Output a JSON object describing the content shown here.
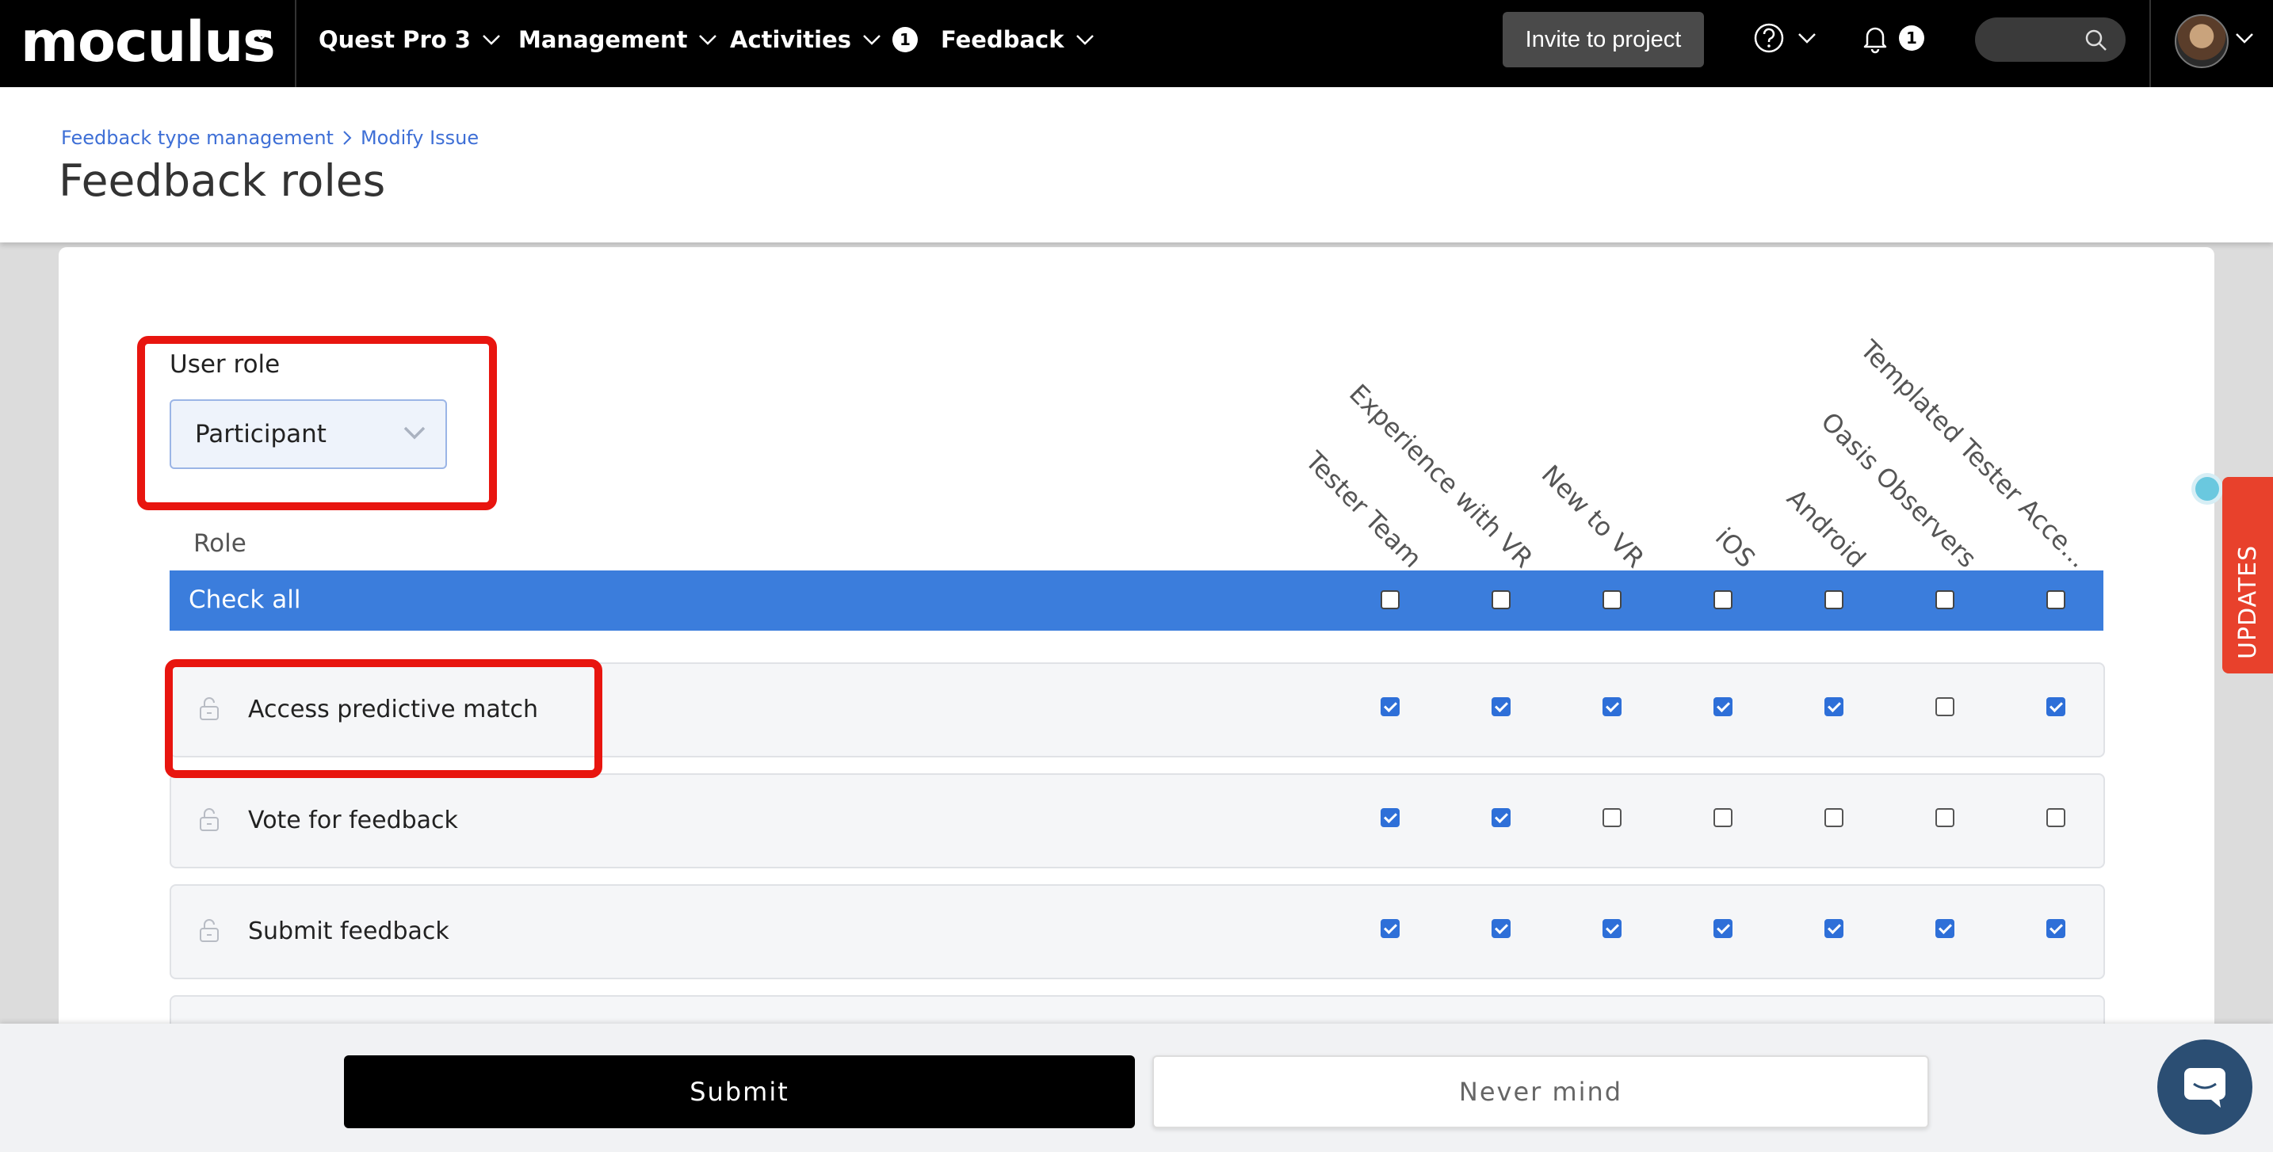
{
  "nav": {
    "logo": "moculus",
    "items": [
      {
        "label": "Quest Pro 3"
      },
      {
        "label": "Management"
      },
      {
        "label": "Activities",
        "badge": "1"
      },
      {
        "label": "Feedback"
      }
    ],
    "invite_label": "Invite to project",
    "notifications_badge": "1",
    "icons": [
      "help-icon",
      "bell-icon",
      "search-icon"
    ]
  },
  "header": {
    "breadcrumb": [
      "Feedback type management",
      "Modify Issue"
    ],
    "title": "Feedback roles"
  },
  "form": {
    "user_role_label": "User role",
    "user_role_value": "Participant",
    "role_header": "Role",
    "check_all_label": "Check all",
    "columns": [
      "Tester Team",
      "Experience with VR",
      "New to VR",
      "iOS",
      "Android",
      "Oasis Observers",
      "Templated Tester Acce..."
    ],
    "check_all_states": [
      false,
      false,
      false,
      false,
      false,
      false,
      false
    ],
    "rows": [
      {
        "label": "Access predictive match",
        "checks": [
          true,
          true,
          true,
          true,
          true,
          false,
          true
        ]
      },
      {
        "label": "Vote for feedback",
        "checks": [
          true,
          true,
          false,
          false,
          false,
          false,
          false
        ]
      },
      {
        "label": "Submit feedback",
        "checks": [
          true,
          true,
          true,
          true,
          true,
          true,
          true
        ]
      }
    ]
  },
  "side": {
    "updates_label": "UPDATES"
  },
  "footer": {
    "submit_label": "Submit",
    "cancel_label": "Never mind"
  },
  "colors": {
    "accent": "#3b7ddc",
    "highlight": "#e8150f",
    "updates": "#e8412c"
  }
}
